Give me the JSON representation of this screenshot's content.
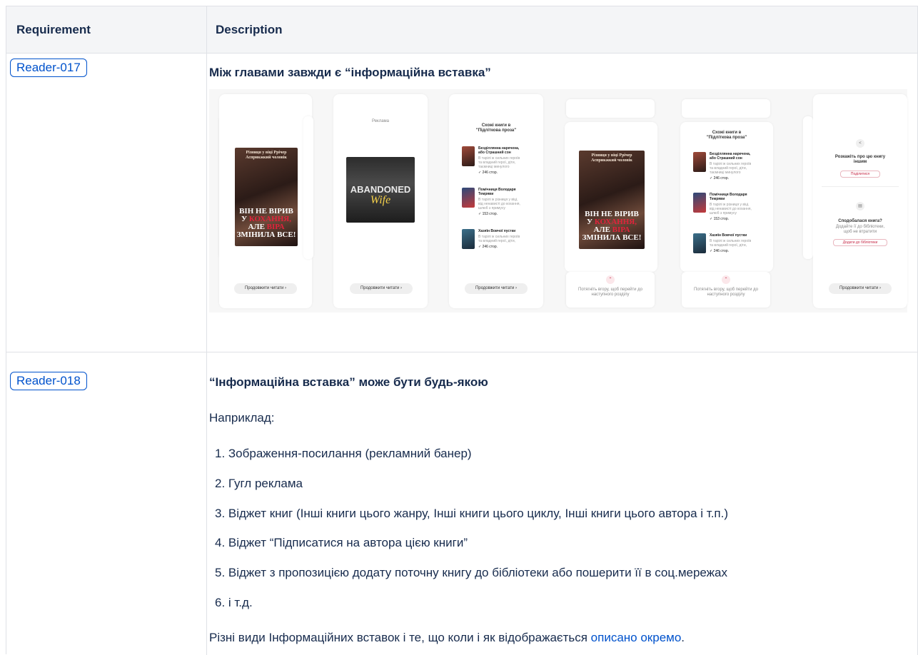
{
  "table": {
    "headers": {
      "requirement": "Requirement",
      "description": "Description"
    },
    "rows": [
      {
        "id": "Reader-017",
        "title": "Між главами завжди є “інформаційна вставка”",
        "mockups": {
          "ad_label": "Реклама",
          "similar_title": "Схожі книги в\n\"Підліткова проза\"",
          "continue_label": "Продовжити читати  ›",
          "swipe_hint": "Потягніть вгору, щоб перейти до наступного розділу",
          "cover_top": "Різниця у віці Ррічер\nАсприкжкий чоловік",
          "cover_title_1": "ВІН НЕ ВІРИВ",
          "cover_title_2a": "У ",
          "cover_title_2b": "КОХАННЯ,",
          "cover_title_3a": "АЛЕ ",
          "cover_title_3b": "ВІРА",
          "cover_title_4": "ЗМІНИЛА ВСЕ!",
          "ad_title_1": "ABANDONED",
          "ad_title_2": "Wife",
          "books": [
            {
              "title": "Безділлянна наречена, або Страшний сон",
              "desc": "В тарілі ж сильних героїв та владний герої, діти, таємниці минулого",
              "pages": "✓ 246 стор."
            },
            {
              "title": "Помічниця Володаря Темряви",
              "desc": "В тарілі ж різниця у віці, від ненависті до кохання, шлюб з примусу",
              "pages": "✓ 153 стор."
            },
            {
              "title": "Хазяїн Вовчої пустки",
              "desc": "В тарілі ж сильних героїв та владний герої, діти,",
              "pages": "✓ 246 стор."
            }
          ],
          "share_title": "Розкажіть про цю книгу іншим",
          "share_btn": "Поділитися",
          "like_title": "Сподобалася книга?",
          "like_desc": "Додайте її до бібліотеки, щоб не втратити",
          "like_btn": "Додати до бібліотеки"
        }
      },
      {
        "id": "Reader-018",
        "title": "“Інформаційна вставка” може бути будь-якою",
        "intro": "Наприклад:",
        "list": [
          "1. Зображення-посилання (рекламний банер)",
          "2. Гугл реклама",
          "3. Віджет книг (Інші книги цього жанру, Інші книги цього циклу, Інші книги цього автора і т.п.)",
          "4. Віджет “Підписатися на автора цією книги”",
          "5. Віджет з пропозицією додату поточну книгу до бібліотеки або пошерити її в соц.мережах",
          "6. і т.д."
        ],
        "footer_before": "Різні види Інформаційних вставок і те, що коли і як відображається ",
        "footer_link": "описано окремо",
        "footer_after": "."
      }
    ]
  },
  "colors": {
    "link": "#0052cc",
    "header_bg": "#f4f5f7",
    "border": "#dfe1e6",
    "text": "#172b4d"
  }
}
